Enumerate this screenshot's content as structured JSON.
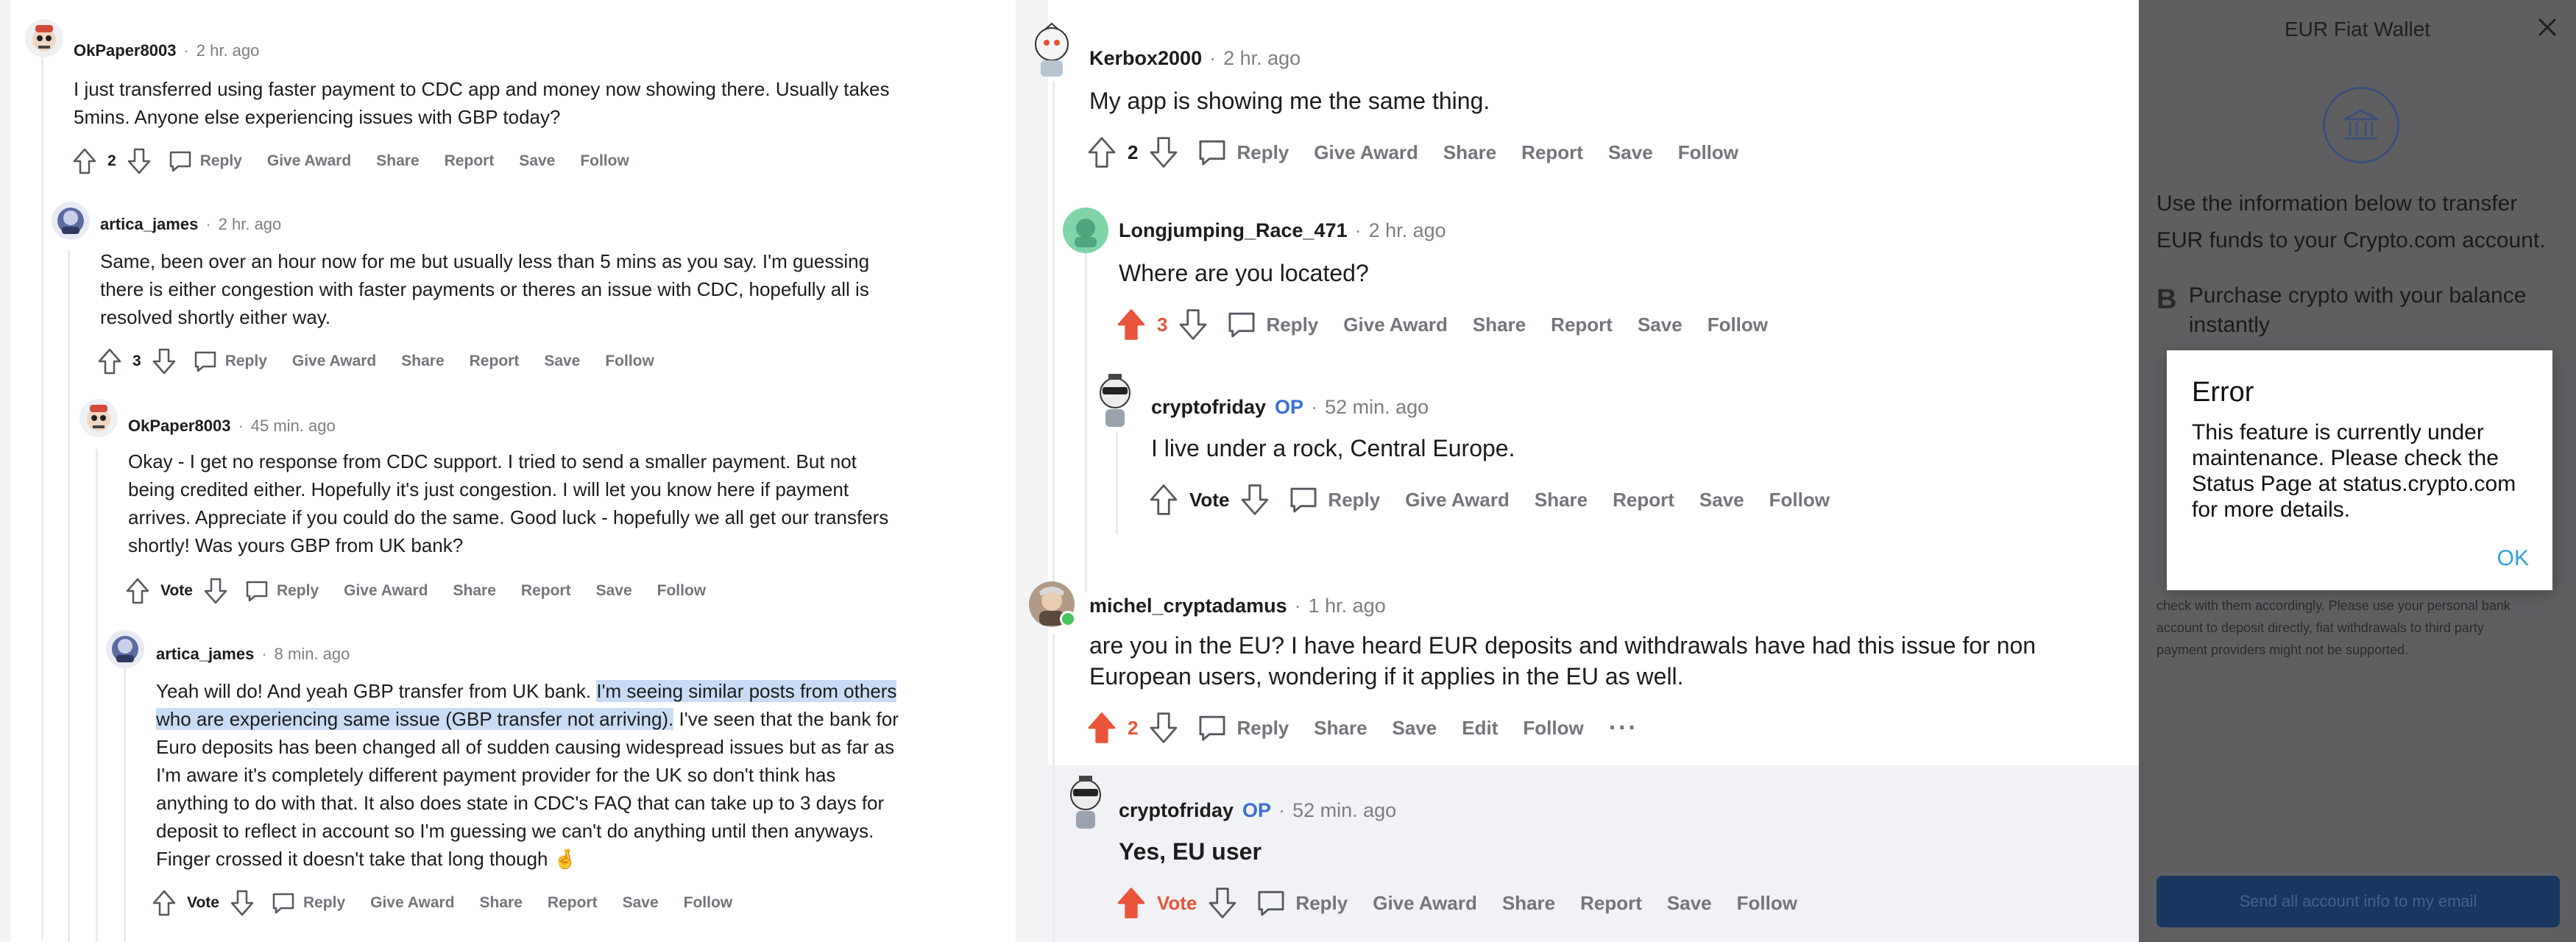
{
  "left": {
    "comments": [
      {
        "user": "OkPaper8003",
        "time": "2 hr. ago",
        "lines": [
          "I just transferred using faster payment to CDC app and money now showing there. Usually takes",
          "5mins. Anyone else experiencing issues with GBP today?"
        ],
        "vote": "2",
        "actions": [
          "Reply",
          "Give Award",
          "Share",
          "Report",
          "Save",
          "Follow"
        ]
      },
      {
        "user": "artica_james",
        "time": "2 hr. ago",
        "lines": [
          "Same, been over an hour now for me but usually less than 5 mins as you say. I'm guessing",
          "there is either congestion with faster payments or theres an issue with CDC, hopefully all is",
          "resolved shortly either way."
        ],
        "vote": "3",
        "actions": [
          "Reply",
          "Give Award",
          "Share",
          "Report",
          "Save",
          "Follow"
        ]
      },
      {
        "user": "OkPaper8003",
        "time": "45 min. ago",
        "lines": [
          "Okay - I get no response from CDC support. I tried to send a smaller payment. But not",
          "being credited either. Hopefully it's just congestion. I will let you know here if payment",
          "arrives. Appreciate if you could do the same. Good luck - hopefully we all get our transfers",
          "shortly! Was yours GBP from UK bank?"
        ],
        "vote": "Vote",
        "actions": [
          "Reply",
          "Give Award",
          "Share",
          "Report",
          "Save",
          "Follow"
        ]
      },
      {
        "user": "artica_james",
        "time": "8 min. ago",
        "line1_plain": "Yeah will do! And yeah GBP transfer from UK bank. ",
        "line1_hl": "I'm seeing similar posts from others",
        "line2_hl": "who are experiencing same issue (GBP transfer not arriving).",
        "line2_plain": " I've seen that the bank for",
        "rest_lines": [
          "Euro deposits has been changed all of sudden causing widespread issues but as far as",
          "I'm aware it's completely different payment provider for the UK so don't think has",
          "anything to do with that. It also does state in CDC's FAQ that can take up to 3 days for",
          "deposit to reflect in account so I'm guessing we can't do anything until then anyways.",
          "Finger crossed it doesn't take that long though 🤞"
        ],
        "vote": "Vote",
        "actions": [
          "Reply",
          "Give Award",
          "Share",
          "Report",
          "Save",
          "Follow"
        ]
      }
    ]
  },
  "middle": {
    "comments": [
      {
        "user": "Kerbox2000",
        "time": "2 hr. ago",
        "text": "My app is showing me the same thing.",
        "vote": "2",
        "actions": [
          "Reply",
          "Give Award",
          "Share",
          "Report",
          "Save",
          "Follow"
        ]
      },
      {
        "user": "Longjumping_Race_471",
        "time": "2 hr. ago",
        "text": "Where are you located?",
        "vote": "3",
        "actions": [
          "Reply",
          "Give Award",
          "Share",
          "Report",
          "Save",
          "Follow"
        ]
      },
      {
        "user": "cryptofriday",
        "op": "OP",
        "time": "52 min. ago",
        "text": "I live under a rock, Central Europe.",
        "vote": "Vote",
        "actions": [
          "Reply",
          "Give Award",
          "Share",
          "Report",
          "Save",
          "Follow"
        ]
      },
      {
        "user": "michel_cryptadamus",
        "time": "1 hr. ago",
        "lines": [
          "are you in the EU? I have heard EUR deposits and withdrawals have had this issue for non",
          "European users, wondering if it applies in the EU as well."
        ],
        "vote": "2",
        "actions": [
          "Reply",
          "Share",
          "Save",
          "Edit",
          "Follow"
        ],
        "more": "···"
      },
      {
        "user": "cryptofriday",
        "op": "OP",
        "time": "52 min. ago",
        "text": "Yes, EU user",
        "vote": "Vote",
        "actions": [
          "Reply",
          "Give Award",
          "Share",
          "Report",
          "Save",
          "Follow"
        ]
      }
    ]
  },
  "wallet": {
    "title": "EUR Fiat Wallet",
    "intro": "Use the information below to transfer EUR funds to your Crypto.com account.",
    "feature": "Purchase crypto with your balance instantly",
    "feature_icon": "B",
    "fine_print_lines": [
      "check with them accordingly. Please use your personal bank",
      "account to deposit directly, fiat withdrawals to third party",
      "payment providers might not be supported."
    ],
    "email_button": "Send all account info to my email",
    "dialog": {
      "title": "Error",
      "message": "This feature is currently under maintenance. Please check the Status Page at status.crypto.com for more details.",
      "ok": "OK"
    }
  },
  "colors": {
    "upvote_active": "#e9543a",
    "op_badge": "#3a6fd6",
    "dialog_ok": "#2d9fd8",
    "highlight": "#c9dcf6"
  }
}
